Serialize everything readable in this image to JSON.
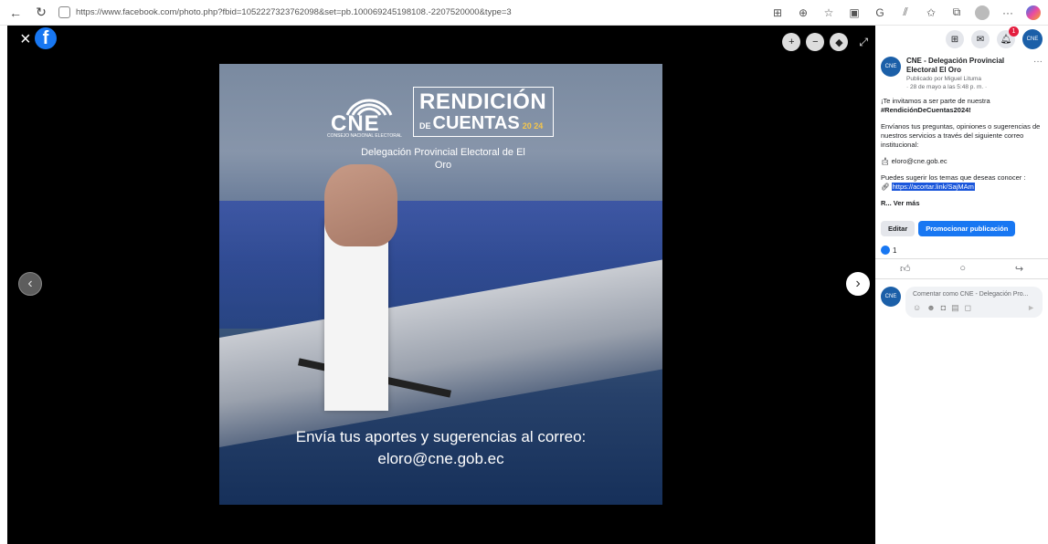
{
  "browser": {
    "url": "https://www.facebook.com/photo.php?fbid=1052227323762098&set=pb.100069245198108.-2207520000&type=3"
  },
  "photo": {
    "brand": "CNE",
    "brand_sub": "CONSEJO NACIONAL ELECTORAL",
    "rendicion": "RENDICIÓN",
    "de": "DE",
    "cuentas": "CUENTAS",
    "year": "20 24",
    "delegacion": "Delegación Provincial Electoral de El Oro",
    "caption_line1": "Envía tus aportes y sugerencias al correo:",
    "caption_line2": "eloro@cne.gob.ec"
  },
  "panel": {
    "notif_count": "1",
    "avatar_text": "CNE",
    "page_name": "CNE - Delegación Provincial Electoral El Oro",
    "published_by": "Publicado por Miguel Lituma",
    "timestamp": "· 28 de mayo a las 5:48 p. m. · ",
    "body_p1a": "¡Te invitamos a ser parte de nuestra",
    "hashtag": "#RendiciónDeCuentas2024!",
    "body_p2": "Envíanos tus preguntas, opiniones o sugerencias de nuestros servicios a través del siguiente correo institucional:",
    "email": "eloro@cne.gob.ec",
    "body_p3": "Puedes sugerir los temas que deseas conocer :",
    "link": "https://acortar.link/SajMAm",
    "ver_mas": "R... Ver más",
    "edit_label": "Editar",
    "promo_label": "Promocionar publicación",
    "reactions": "1",
    "comment_placeholder": "Comentar como CNE - Delegación Pro..."
  }
}
